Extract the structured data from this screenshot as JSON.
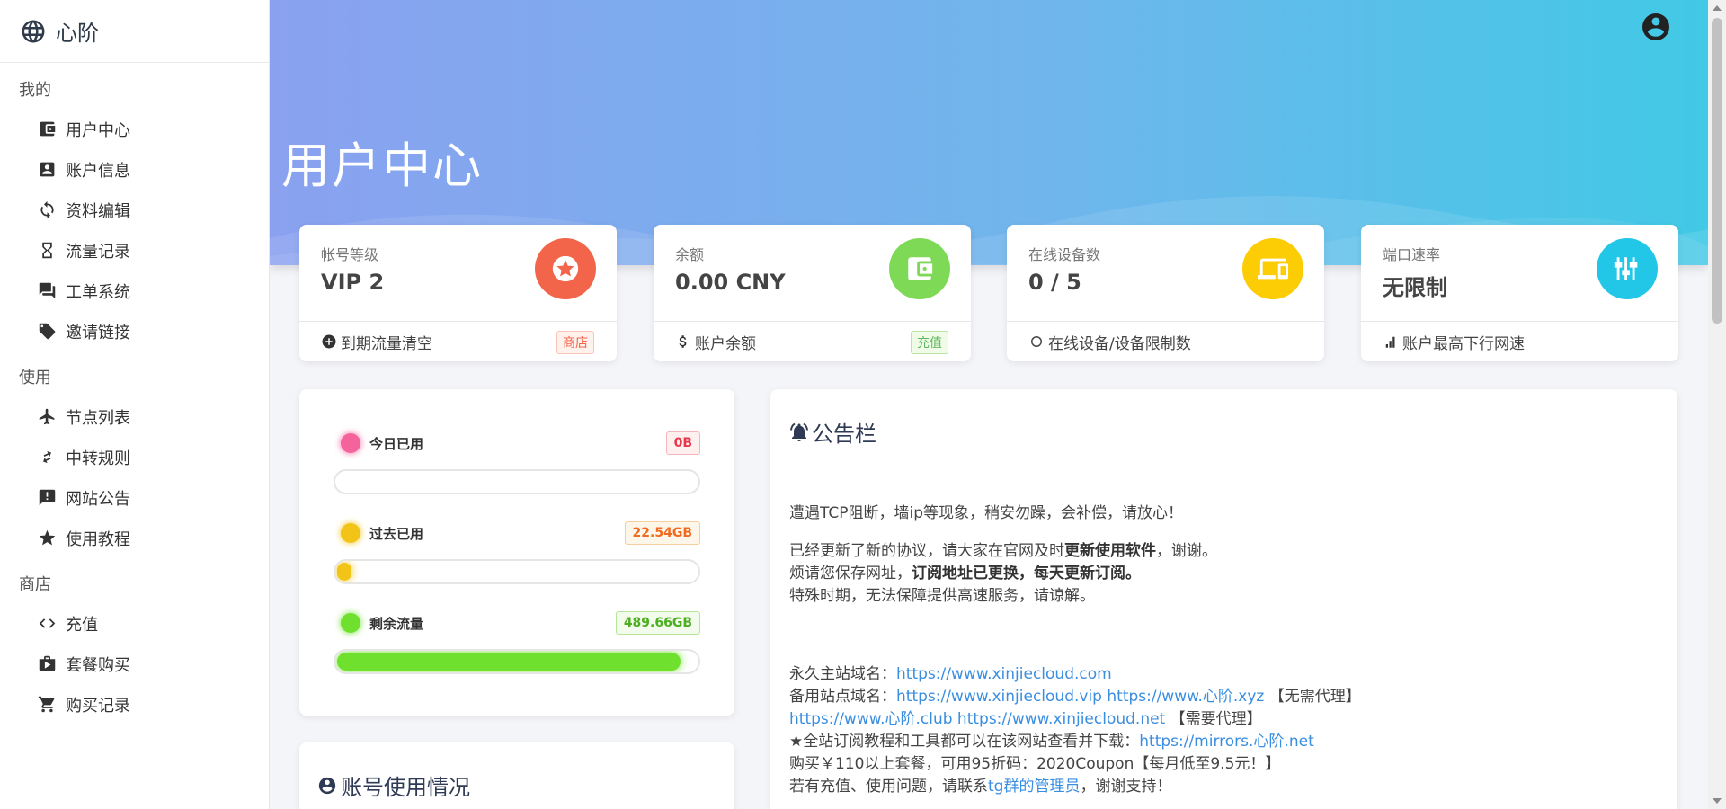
{
  "brand": {
    "name": "心阶"
  },
  "sidebar": {
    "sections": [
      {
        "title": "我的",
        "items": [
          {
            "label": "用户中心",
            "icon": "wallet-icon"
          },
          {
            "label": "账户信息",
            "icon": "account-box-icon"
          },
          {
            "label": "资料编辑",
            "icon": "sync-icon"
          },
          {
            "label": "流量记录",
            "icon": "hourglass-icon"
          },
          {
            "label": "工单系统",
            "icon": "forum-icon"
          },
          {
            "label": "邀请链接",
            "icon": "tag-icon"
          }
        ]
      },
      {
        "title": "使用",
        "items": [
          {
            "label": "节点列表",
            "icon": "airplane-icon"
          },
          {
            "label": "中转规则",
            "icon": "transfer-icon"
          },
          {
            "label": "网站公告",
            "icon": "announcement-icon"
          },
          {
            "label": "使用教程",
            "icon": "star-icon"
          }
        ]
      },
      {
        "title": "商店",
        "items": [
          {
            "label": "充值",
            "icon": "code-icon"
          },
          {
            "label": "套餐购买",
            "icon": "shop-icon"
          },
          {
            "label": "购买记录",
            "icon": "cart-icon"
          }
        ]
      }
    ]
  },
  "header": {
    "title": "用户中心"
  },
  "stats": [
    {
      "label": "帐号等级",
      "value": "VIP 2",
      "footer": "到期流量清空",
      "badge": "商店",
      "color": "#f2654a",
      "icon": "star-badge-icon",
      "foot_icon": "plus-circle-icon"
    },
    {
      "label": "余额",
      "value": "0.00 CNY",
      "footer": "账户余额",
      "badge": "充值",
      "color": "#7ed957",
      "icon": "wallet-icon",
      "foot_icon": "dollar-icon"
    },
    {
      "label": "在线设备数",
      "value": "0 / 5",
      "footer": "在线设备/设备限制数",
      "badge": "",
      "color": "#fccc04",
      "icon": "devices-icon",
      "foot_icon": "refresh-icon"
    },
    {
      "label": "端口速率",
      "value": "无限制",
      "footer": "账户最高下行网速",
      "badge": "",
      "color": "#22c7e8",
      "icon": "tune-icon",
      "foot_icon": "signal-icon"
    }
  ],
  "traffic": {
    "today": {
      "label": "今日已用",
      "value": "0B",
      "fraction": 0.0,
      "color": "#f4639b"
    },
    "past": {
      "label": "过去已用",
      "value": "22.54GB",
      "fraction": 0.044,
      "color": "#f2c418"
    },
    "remaining": {
      "label": "剩余流量",
      "value": "489.66GB",
      "fraction": 0.956,
      "color": "#6fe02e"
    }
  },
  "usage": {
    "title": "账号使用情况"
  },
  "notice": {
    "title": "公告栏",
    "line1": "遭遇TCP阻断，墙ip等现象，稍安勿躁，会补偿，请放心！",
    "p2_a": "已经更新了新的协议，请大家在官网及时",
    "p2_b": "更新使用软件",
    "p2_c": "，谢谢。",
    "p3_a": "烦请您保存网址，",
    "p3_b": "订阅地址已更换，每天更新订阅。",
    "p4": "特殊时期，无法保障提供高速服务，请谅解。",
    "l1_label": "永久主站域名：",
    "l1_link": "https://www.xinjiecloud.com",
    "l2_label": "备用站点域名：",
    "l2_link": "https://www.xinjiecloud.vip https://www.心阶.xyz",
    "l2_tag": " 【无需代理】",
    "l3_link": "https://www.心阶.club https://www.xinjiecloud.net",
    "l3_tag": " 【需要代理】",
    "l4_label": "★全站订阅教程和工具都可以在该网站查看并下载：",
    "l4_link": "https://mirrors.心阶.net",
    "l5": "购买￥110以上套餐，可用95折码：2020Coupon【每月低至9.5元！】",
    "l6_a": "若有充值、使用问题，请联系",
    "l6_link": "tg群的管理员",
    "l6_b": "，谢谢支持！"
  }
}
